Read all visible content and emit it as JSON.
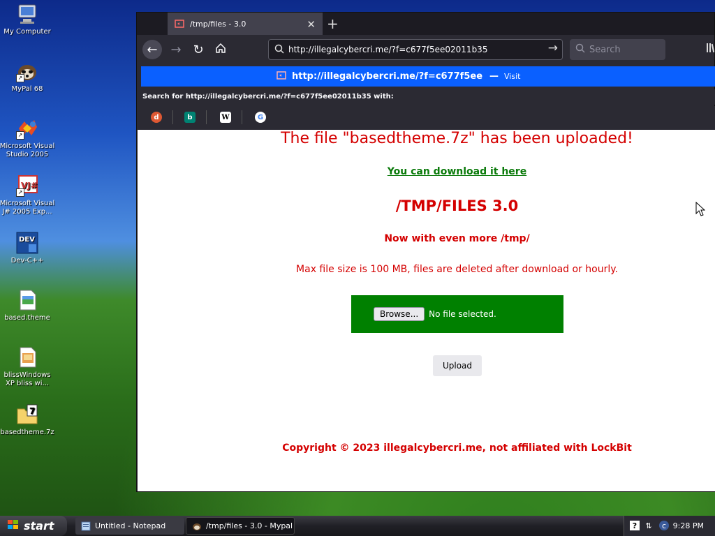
{
  "desktop": {
    "icons": [
      {
        "label": "My Computer",
        "icon": "computer-icon"
      },
      {
        "label": "MyPal 68",
        "icon": "mypal-icon"
      },
      {
        "label": "Microsoft Visual Studio 2005",
        "icon": "visual-studio-icon"
      },
      {
        "label": "Microsoft Visual J# 2005 Exp...",
        "icon": "visual-jsharp-icon"
      },
      {
        "label": "Dev-C++",
        "icon": "devcpp-icon"
      },
      {
        "label": "based.theme",
        "icon": "theme-file-icon"
      },
      {
        "label": "blissWindows XP bliss wi...",
        "icon": "image-file-icon"
      },
      {
        "label": "basedtheme.7z",
        "icon": "archive-icon"
      }
    ]
  },
  "browser": {
    "tab_title": "/tmp/files - 3.0",
    "url": "http://illegalcybercri.me/?f=c677f5ee02011b35",
    "search_placeholder": "Search",
    "suggestion": {
      "url": "http://illegalcybercri.me/?f=c677f5ee",
      "dash": "—",
      "visit": "Visit"
    },
    "search_with": "Search for http://illegalcybercri.me/?f=c677f5ee02011b35 with:",
    "engines": [
      "duckduckgo-icon",
      "bing-icon",
      "wikipedia-icon",
      "google-icon"
    ]
  },
  "page": {
    "uploaded_msg": "The file \"basedtheme.7z\" has been uploaded!",
    "download_link": "You can download it here",
    "title": "/TMP/FILES 3.0",
    "tagline": "Now with even more /tmp/",
    "max_size": "Max file size is 100 MB, files are deleted after download or hourly.",
    "browse_label": "Browse...",
    "no_file": "No file selected.",
    "upload_label": "Upload",
    "copyright": "Copyright © 2023 illegalcybercri.me, not affiliated with LockBit",
    "colors": {
      "red": "#d40000",
      "green_box": "#008000",
      "link_green": "#0a7a0a"
    }
  },
  "taskbar": {
    "start_label": "start",
    "tasks": [
      {
        "label": "Untitled - Notepad",
        "active": false
      },
      {
        "label": "/tmp/files - 3.0 - Mypal",
        "active": true
      }
    ],
    "clock": "9:28 PM"
  }
}
